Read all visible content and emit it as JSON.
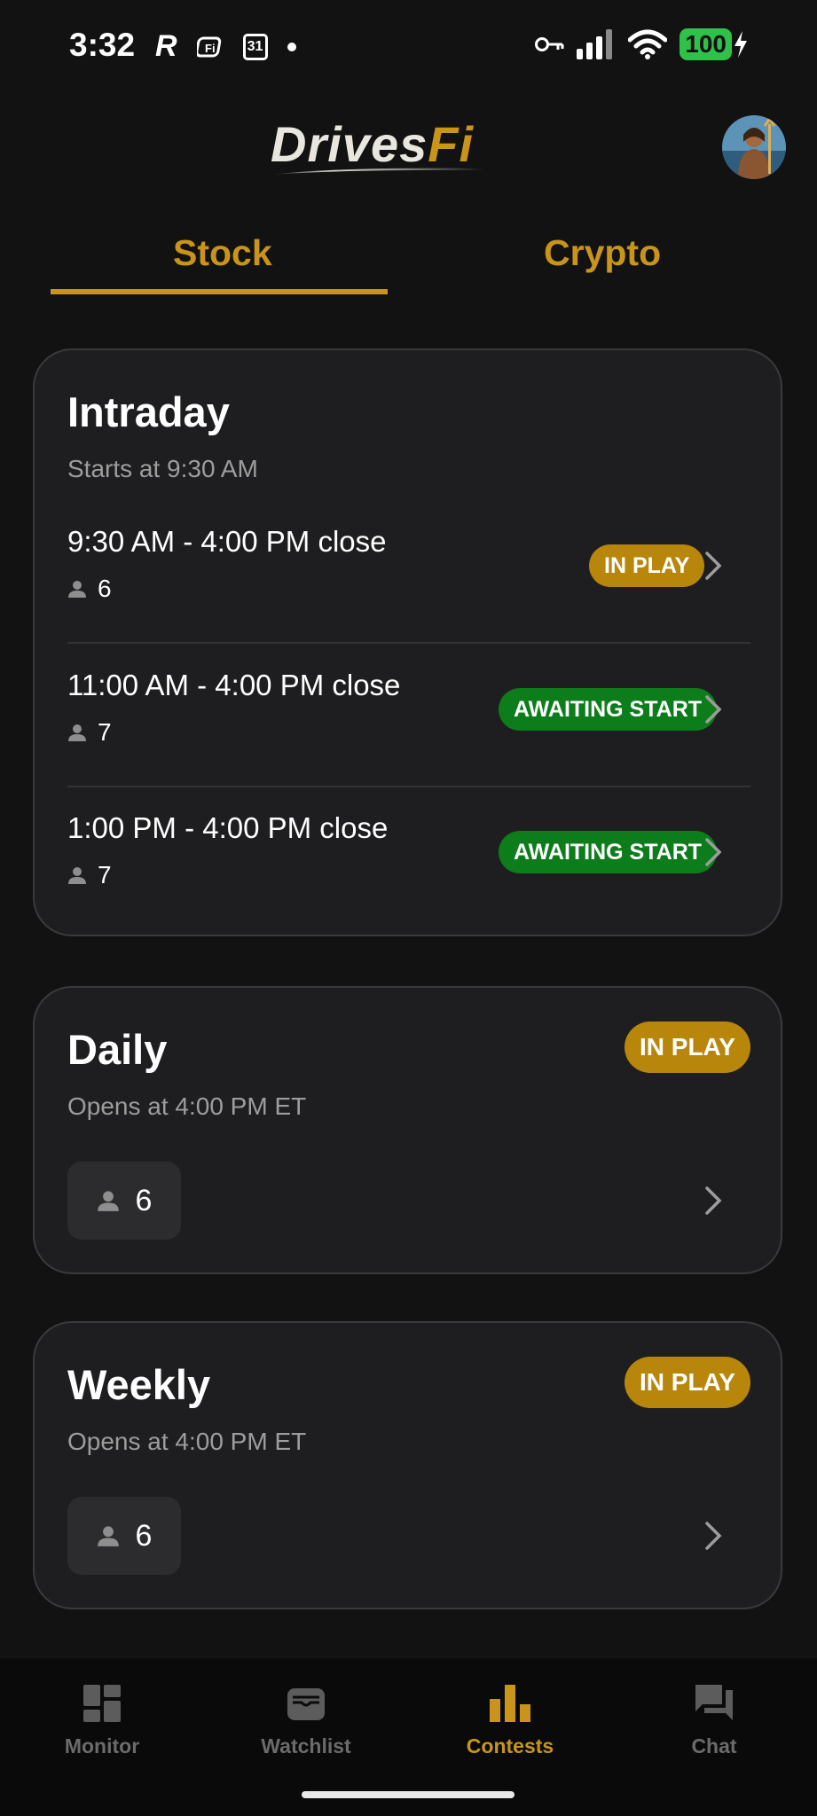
{
  "status": {
    "time": "3:32",
    "left_icons": [
      "r-app-icon",
      "fi-app-icon",
      "calendar-icon",
      "dot-icon"
    ],
    "calendar_day": "31",
    "battery": "100"
  },
  "header": {
    "logo_part1": "Drives",
    "logo_part2": "Fi",
    "avatar_icon": "avatar"
  },
  "tabs": {
    "stock": "Stock",
    "crypto": "Crypto",
    "active": "Stock"
  },
  "intraday": {
    "title": "Intraday",
    "subtitle": "Starts at 9:30 AM",
    "rows": [
      {
        "time": "9:30 AM - 4:00 PM close",
        "count": "6",
        "badge": "IN PLAY"
      },
      {
        "time": "11:00 AM - 4:00 PM close",
        "count": "7",
        "badge": "AWAITING START"
      },
      {
        "time": "1:00 PM - 4:00 PM close",
        "count": "7",
        "badge": "AWAITING START"
      }
    ]
  },
  "daily": {
    "title": "Daily",
    "subtitle": "Opens at 4:00 PM ET",
    "badge": "IN PLAY",
    "count": "6"
  },
  "weekly": {
    "title": "Weekly",
    "subtitle": "Opens at 4:00 PM ET",
    "badge": "IN PLAY",
    "count": "6"
  },
  "nav": {
    "items": [
      {
        "label": "Monitor",
        "icon": "dashboard-icon"
      },
      {
        "label": "Watchlist",
        "icon": "wallet-icon"
      },
      {
        "label": "Contests",
        "icon": "bar-chart-icon"
      },
      {
        "label": "Chat",
        "icon": "chat-icon"
      }
    ],
    "active": "Contests"
  },
  "colors": {
    "background": "#121212",
    "card": "#1e1e20",
    "accent": "#c8951a",
    "in_play": "#b8860b",
    "awaiting": "#0c7d1a",
    "muted_text": "#9d9d9d",
    "nav_inactive": "#6b6b6b"
  }
}
